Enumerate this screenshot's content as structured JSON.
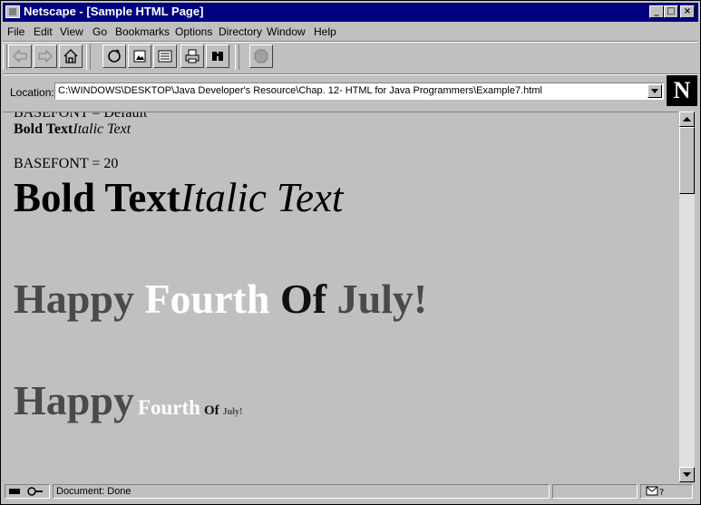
{
  "window": {
    "title": "Netscape - [Sample HTML Page]",
    "minimize": "_",
    "maximize": "□",
    "close": "×"
  },
  "menu": [
    "File",
    "Edit",
    "View",
    "Go",
    "Bookmarks",
    "Options",
    "Directory",
    "Window",
    "Help"
  ],
  "toolbar": {
    "buttons": [
      "back-icon",
      "forward-icon",
      "home-icon",
      "reload-icon",
      "images-icon",
      "open-icon",
      "print-icon",
      "find-icon",
      "stop-icon"
    ]
  },
  "location": {
    "label": "Location:",
    "url": "C:\\WINDOWS\\DESKTOP\\Java Developer's Resource\\Chap. 12- HTML for Java Programmers\\Example7.html",
    "logo": "N"
  },
  "content": {
    "top_partial": "BASEFONT = Default",
    "line1_bold": "Bold Text",
    "line1_italic": "Italic Text",
    "basefont20": "BASEFONT = 20",
    "line2_bold": "Bold Text",
    "line2_italic": "Italic Text",
    "happy1": [
      "Happy",
      "Fourth",
      "Of",
      "July!"
    ],
    "happy2": [
      "Happy",
      "Fourth",
      "Of",
      "July!"
    ],
    "colors": {
      "gray": "#4a4a4a",
      "white": "#ffffff",
      "black": "#111111"
    }
  },
  "status": {
    "text": "Document: Done"
  }
}
